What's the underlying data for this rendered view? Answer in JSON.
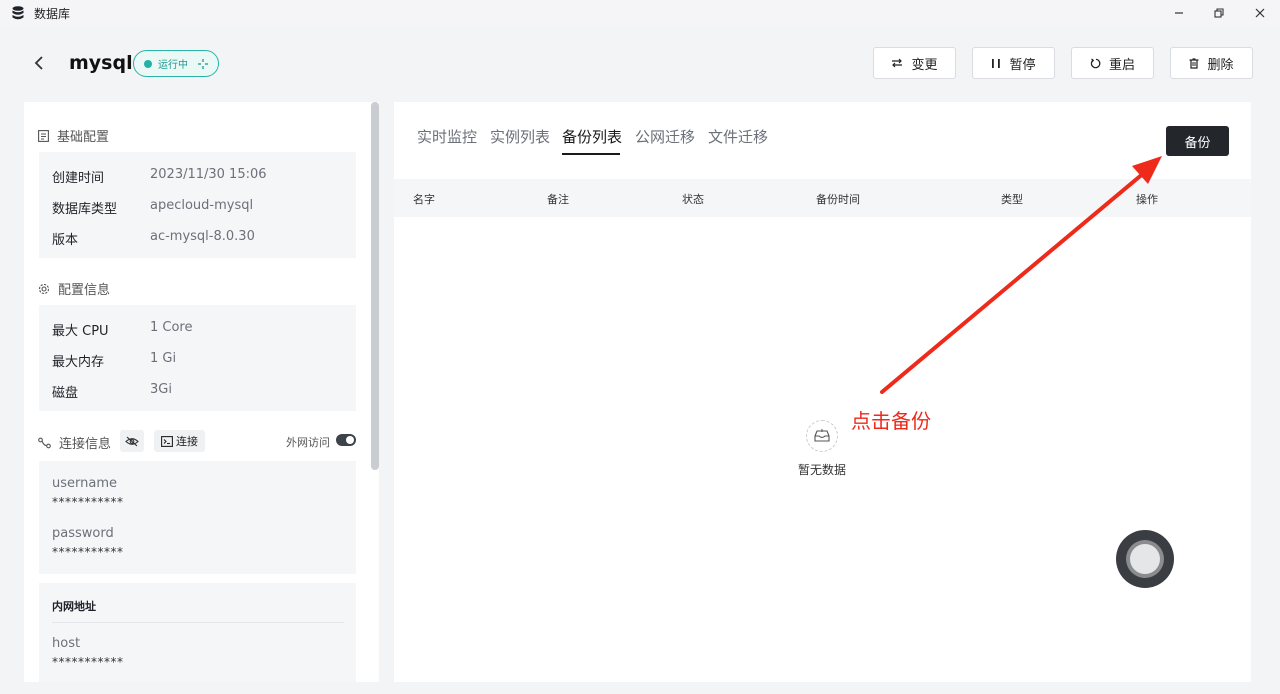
{
  "window": {
    "title": "数据库"
  },
  "header": {
    "db_name": "mysql",
    "status": "运行中",
    "buttons": {
      "change": "变更",
      "pause": "暂停",
      "restart": "重启",
      "delete": "删除"
    }
  },
  "left": {
    "basic": {
      "title": "基础配置",
      "rows": [
        {
          "k": "创建时间",
          "v": "2023/11/30 15:06"
        },
        {
          "k": "数据库类型",
          "v": "apecloud-mysql"
        },
        {
          "k": "版本",
          "v": "ac-mysql-8.0.30"
        }
      ]
    },
    "config": {
      "title": "配置信息",
      "rows": [
        {
          "k": "最大 CPU",
          "v": "1 Core"
        },
        {
          "k": "最大内存",
          "v": "1 Gi"
        },
        {
          "k": "磁盘",
          "v": "3Gi"
        }
      ]
    },
    "connection": {
      "title": "连接信息",
      "connect_label": "连接",
      "public_access_label": "外网访问",
      "public_access_on": true,
      "username_label": "username",
      "username_value": "***********",
      "password_label": "password",
      "password_value": "***********",
      "internal_title": "内网地址",
      "host_label": "host",
      "host_value": "***********"
    }
  },
  "right": {
    "tabs": [
      "实时监控",
      "实例列表",
      "备份列表",
      "公网迁移",
      "文件迁移"
    ],
    "active_tab": "备份列表",
    "backup_button": "备份",
    "columns": [
      "名字",
      "备注",
      "状态",
      "备份时间",
      "类型",
      "操作"
    ],
    "empty_text": "暂无数据"
  },
  "annotation": {
    "text": "点击备份",
    "color": "#ee2a1b"
  },
  "colors": {
    "status": "#22b3a5",
    "primary_button": "#23272c"
  }
}
